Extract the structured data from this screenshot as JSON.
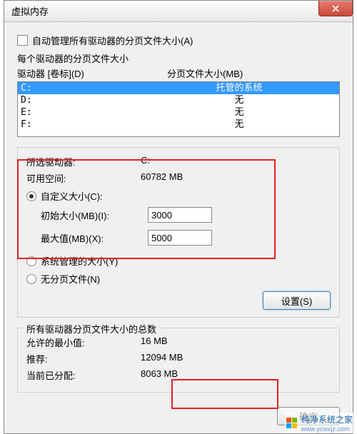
{
  "title": "虚拟内存",
  "auto_manage_label": "自动管理所有驱动器的分页文件大小(A)",
  "per_drive_label": "每个驱动器的分页文件大小",
  "list_header": {
    "drive": "驱动器 [卷标](D)",
    "size": "分页文件大小(MB)"
  },
  "drives": [
    {
      "letter": "C:",
      "size": "托管的系统",
      "selected": true
    },
    {
      "letter": "D:",
      "size": "无",
      "selected": false
    },
    {
      "letter": "E:",
      "size": "无",
      "selected": false
    },
    {
      "letter": "F:",
      "size": "无",
      "selected": false
    }
  ],
  "selected_drive_label": "所选驱动器:",
  "selected_drive_value": "C:",
  "free_label": "可用空间:",
  "free_value": "60782 MB",
  "radio_custom": "自定义大小(C):",
  "initial_label": "初始大小(MB)(I):",
  "initial_value": "3000",
  "max_label": "最大值(MB)(X):",
  "max_value": "5000",
  "radio_system": "系统管理的大小(Y)",
  "radio_none": "无分页文件(N)",
  "set_btn": "设置(S)",
  "totals_label": "所有驱动器分页文件大小的总数",
  "min_allowed_label": "允许的最小值:",
  "min_allowed_value": "16 MB",
  "recommended_label": "推荐:",
  "recommended_value": "12094 MB",
  "current_label": "当前已分配:",
  "current_value": "8063 MB",
  "ok_btn": "确定",
  "watermark": {
    "text": "纯净系统之家",
    "url": "www.ycwxjz.com"
  }
}
